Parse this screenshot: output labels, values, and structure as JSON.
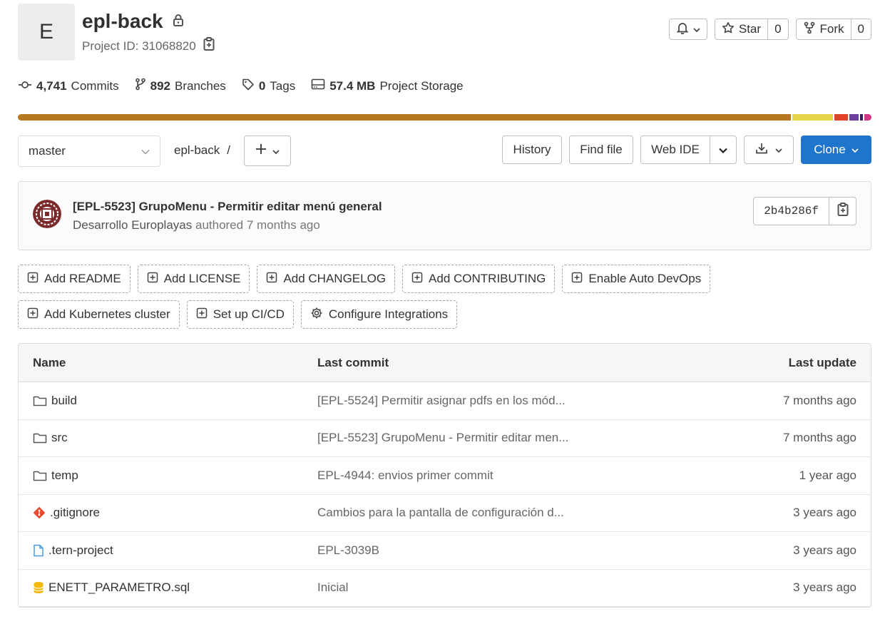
{
  "project": {
    "avatar_letter": "E",
    "name": "epl-back",
    "id_label": "Project ID: 31068820"
  },
  "header_buttons": {
    "star_label": "Star",
    "star_count": "0",
    "fork_label": "Fork",
    "fork_count": "0"
  },
  "stats": {
    "commits_count": "4,741",
    "commits_label": "Commits",
    "branches_count": "892",
    "branches_label": "Branches",
    "tags_count": "0",
    "tags_label": "Tags",
    "storage_count": "57.4 MB",
    "storage_label": "Project Storage"
  },
  "language_bar": [
    {
      "color": "#b7791f",
      "share": 0.913
    },
    {
      "color": "#e6d54a",
      "share": 0.048
    },
    {
      "color": "#e24329",
      "share": 0.016
    },
    {
      "color": "#6b3fa0",
      "share": 0.011
    },
    {
      "color": "#3b1d5c",
      "share": 0.004
    },
    {
      "color": "#d63384",
      "share": 0.008
    }
  ],
  "toolbar": {
    "branch": "master",
    "breadcrumb_repo": "epl-back",
    "breadcrumb_sep": "/",
    "history": "History",
    "find_file": "Find file",
    "web_ide": "Web IDE",
    "clone": "Clone"
  },
  "last_commit": {
    "title": "[EPL-5523] GrupoMenu - Permitir editar menú general",
    "author": "Desarrollo Europlayas",
    "authored": "authored 7 months ago",
    "sha": "2b4b286f"
  },
  "actions": [
    {
      "label": "Add README",
      "icon": "plus-square-icon"
    },
    {
      "label": "Add LICENSE",
      "icon": "plus-square-icon"
    },
    {
      "label": "Add CHANGELOG",
      "icon": "plus-square-icon"
    },
    {
      "label": "Add CONTRIBUTING",
      "icon": "plus-square-icon"
    },
    {
      "label": "Enable Auto DevOps",
      "icon": "plus-square-icon"
    },
    {
      "label": "Add Kubernetes cluster",
      "icon": "plus-square-icon"
    },
    {
      "label": "Set up CI/CD",
      "icon": "plus-square-icon"
    },
    {
      "label": "Configure Integrations",
      "icon": "settings-icon"
    }
  ],
  "table": {
    "headers": {
      "name": "Name",
      "last_commit": "Last commit",
      "last_update": "Last update"
    },
    "rows": [
      {
        "name": "build",
        "type": "folder-icon",
        "commit": "[EPL-5524] Permitir asignar pdfs en los mód...",
        "updated": "7 months ago"
      },
      {
        "name": "src",
        "type": "folder-icon",
        "commit": "[EPL-5523] GrupoMenu - Permitir editar men...",
        "updated": "7 months ago"
      },
      {
        "name": "temp",
        "type": "folder-icon",
        "commit": "EPL-4944: envios primer commit",
        "updated": "1 year ago"
      },
      {
        "name": ".gitignore",
        "type": "git-icon",
        "commit": "Cambios para la pantalla de configuración d...",
        "updated": "3 years ago"
      },
      {
        "name": ".tern-project",
        "type": "file-icon",
        "commit": "EPL-3039B",
        "updated": "3 years ago"
      },
      {
        "name": "ENETT_PARAMETRO.sql",
        "type": "database-icon",
        "commit": "Inicial",
        "updated": "3 years ago"
      }
    ]
  }
}
